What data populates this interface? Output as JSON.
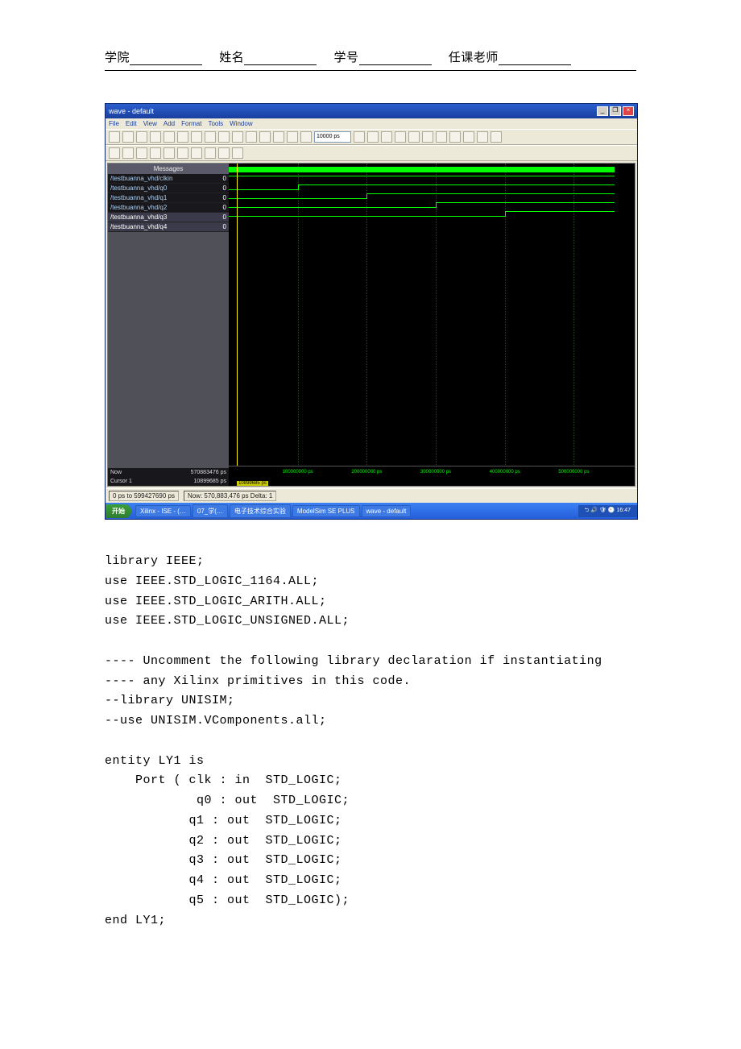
{
  "header": {
    "college_label": "学院",
    "name_label": "姓名",
    "id_label": "学号",
    "teacher_label": "任课老师"
  },
  "app": {
    "title": "wave - default",
    "menu": [
      "File",
      "Edit",
      "View",
      "Add",
      "Format",
      "Tools",
      "Window"
    ],
    "time_input": "10000 ps",
    "signal_header": "Messages",
    "signals": [
      {
        "name": "/testbuanna_vhd/clkin",
        "val": "0"
      },
      {
        "name": "/testbuanna_vhd/q0",
        "val": "0"
      },
      {
        "name": "/testbuanna_vhd/q1",
        "val": "0"
      },
      {
        "name": "/testbuanna_vhd/q2",
        "val": "0"
      },
      {
        "name": "/testbuanna_vhd/q3",
        "val": "0"
      },
      {
        "name": "/testbuanna_vhd/q4",
        "val": "0"
      }
    ],
    "now_label": "Now",
    "now_value": "570883476 ps",
    "cursor_label": "Cursor 1",
    "cursor_value": "10899685 ps",
    "cursor_box": "10899685 ps",
    "ticks": [
      "100000000 ps",
      "200000000 ps",
      "300000000 ps",
      "400000000 ps",
      "500000000 ps"
    ],
    "status_left": "0 ps to 599427690 ps",
    "status_right": "Now: 570,883,476 ps  Delta: 1"
  },
  "taskbar": {
    "start": "开始",
    "tasks": [
      "Xilinx - ISE - (…",
      "07_学(…",
      "电子技术综合实验",
      "ModelSim SE PLUS",
      "wave - default"
    ],
    "tray": "⮌ 🔊 🛡 🕙 16:47"
  },
  "code_lines": [
    "library IEEE;",
    "use IEEE.STD_LOGIC_1164.ALL;",
    "use IEEE.STD_LOGIC_ARITH.ALL;",
    "use IEEE.STD_LOGIC_UNSIGNED.ALL;",
    "",
    "---- Uncomment the following library declaration if instantiating",
    "---- any Xilinx primitives in this code.",
    "--library UNISIM;",
    "--use UNISIM.VComponents.all;",
    "",
    "entity LY1 is",
    "    Port ( clk : in  STD_LOGIC;",
    "            q0 : out  STD_LOGIC;",
    "           q1 : out  STD_LOGIC;",
    "           q2 : out  STD_LOGIC;",
    "           q3 : out  STD_LOGIC;",
    "           q4 : out  STD_LOGIC;",
    "           q5 : out  STD_LOGIC);",
    "end LY1;"
  ],
  "chart_data": {
    "type": "waveform",
    "x_unit": "ps",
    "x_range": [
      0,
      599427690
    ],
    "cursor": 10899685,
    "now": 570883476,
    "signals": [
      {
        "name": "clkin",
        "kind": "clock",
        "value_at_cursor": "0"
      },
      {
        "name": "q0",
        "transitions_high_at": 0,
        "value_at_cursor": "0"
      },
      {
        "name": "q1",
        "transitions_high_at": 100000000,
        "value_at_cursor": "0"
      },
      {
        "name": "q2",
        "transitions_high_at": 200000000,
        "value_at_cursor": "0"
      },
      {
        "name": "q3",
        "transitions_high_at": 300000000,
        "value_at_cursor": "0"
      },
      {
        "name": "q4",
        "transitions_high_at": 400000000,
        "value_at_cursor": "0"
      }
    ]
  }
}
